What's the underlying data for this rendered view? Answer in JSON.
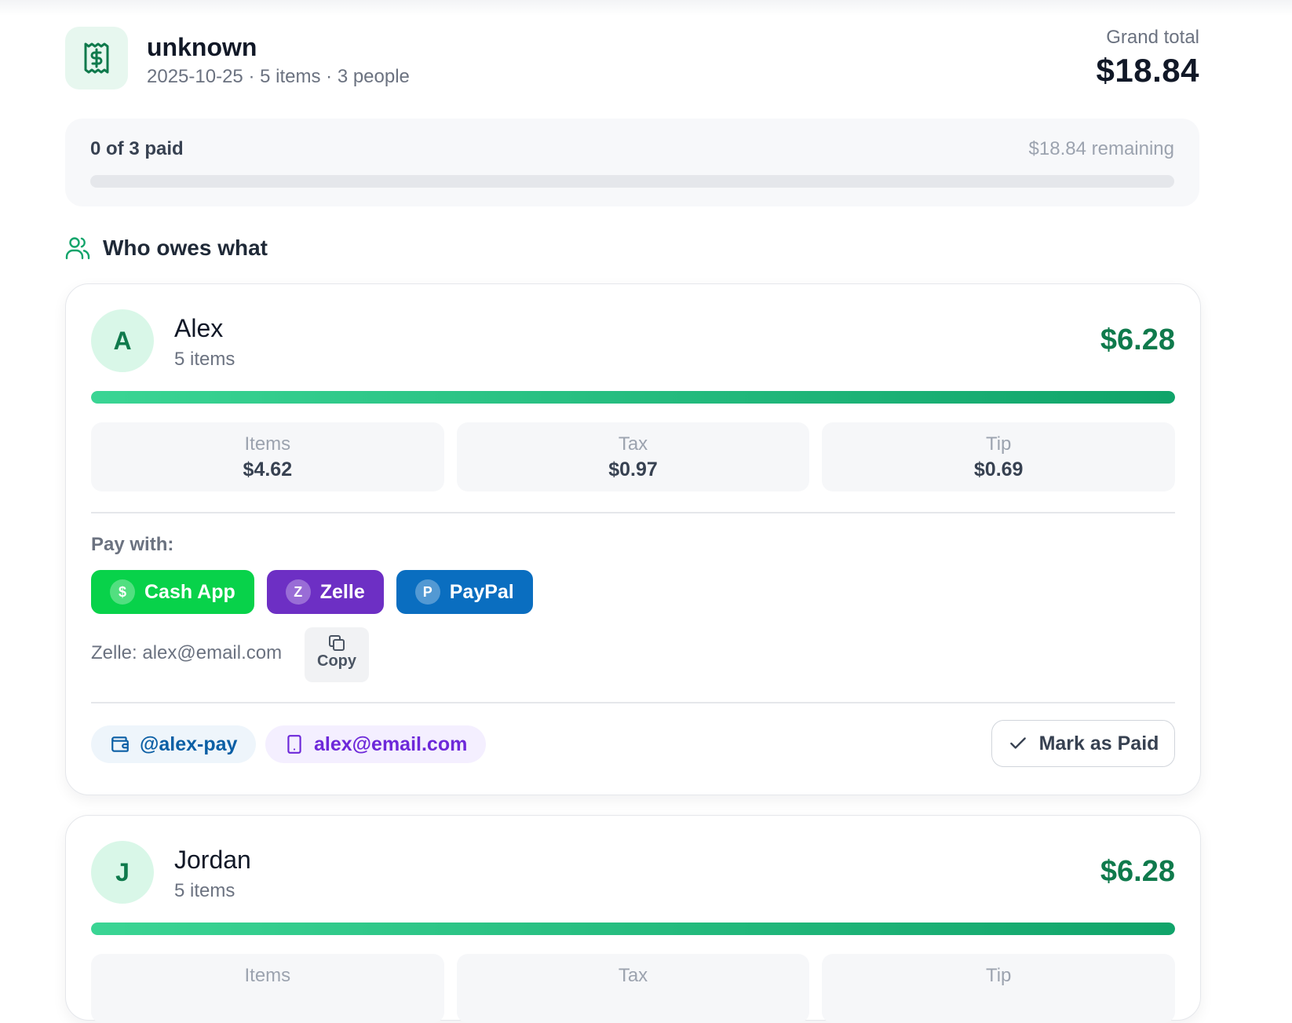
{
  "header": {
    "title": "unknown",
    "date": "2025-10-25",
    "items": "5 items",
    "people": "3 people",
    "separator": "·",
    "grand_total_label": "Grand total",
    "grand_total": "$18.84"
  },
  "summary": {
    "paid_text": "0 of 3 paid",
    "remaining": "$18.84 remaining",
    "paid_fraction": 0
  },
  "section": {
    "title": "Who owes what"
  },
  "people": [
    {
      "initial": "A",
      "name": "Alex",
      "items": "5 items",
      "total": "$6.28",
      "share_fraction": 1,
      "stats": [
        {
          "label": "Items",
          "value": "$4.62"
        },
        {
          "label": "Tax",
          "value": "$0.97"
        },
        {
          "label": "Tip",
          "value": "$0.69"
        }
      ],
      "pay_with_label": "Pay with:",
      "pay_buttons": [
        {
          "badge": "$",
          "label": "Cash App"
        },
        {
          "badge": "Z",
          "label": "Zelle"
        },
        {
          "badge": "P",
          "label": "PayPal"
        }
      ],
      "selected_handle": "Zelle: alex@email.com",
      "copy_label": "Copy",
      "cashapp_handle": "@alex-pay",
      "zelle_handle": "alex@email.com",
      "mark_paid_label": "Mark as Paid"
    },
    {
      "initial": "J",
      "name": "Jordan",
      "items": "5 items",
      "total": "$6.28",
      "share_fraction": 1,
      "stats": [
        {
          "label": "Items"
        },
        {
          "label": "Tax"
        },
        {
          "label": "Tip"
        }
      ]
    }
  ],
  "colors": {
    "accent_green": "#0f7a4c",
    "cashapp": "#08d24a",
    "zelle": "#6d2fc4",
    "paypal": "#0a6ec0"
  }
}
